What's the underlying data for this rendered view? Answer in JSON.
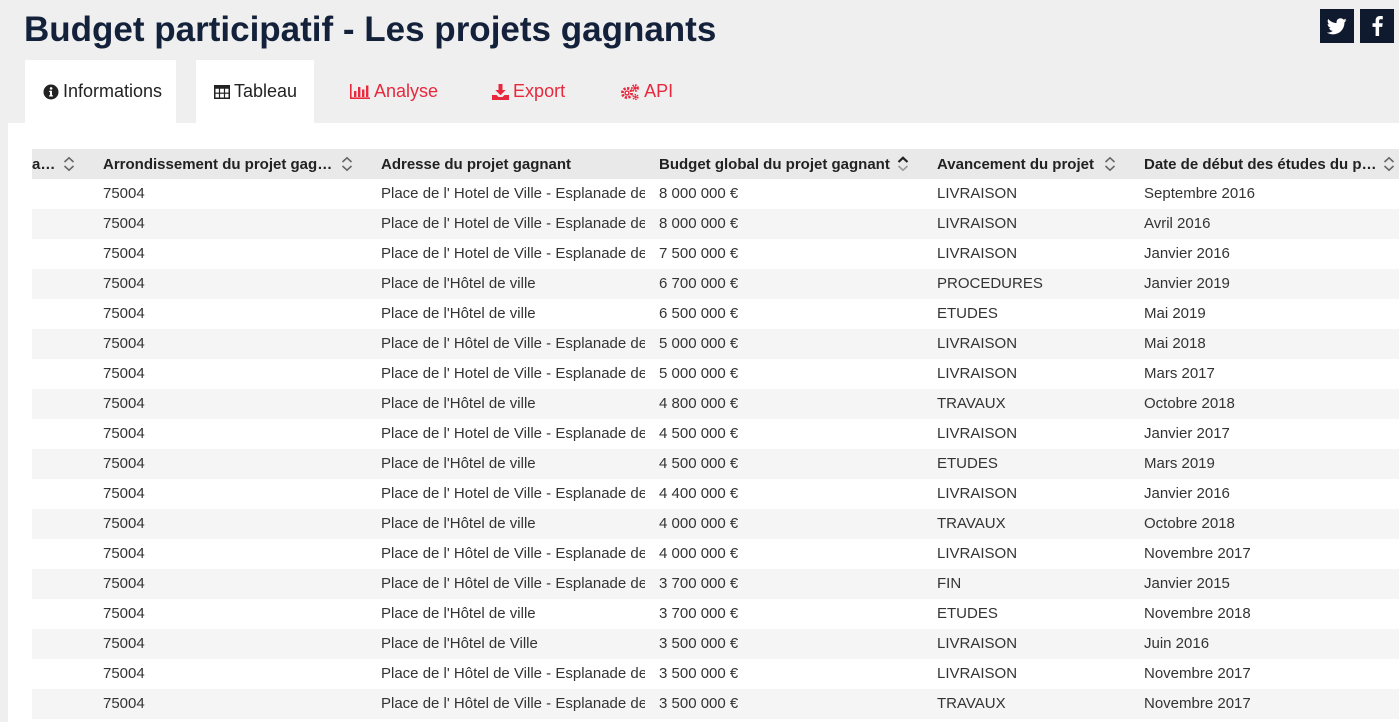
{
  "page": {
    "title": "Budget participatif - Les projets gagnants"
  },
  "social": [
    {
      "name": "twitter-icon"
    },
    {
      "name": "facebook-icon"
    }
  ],
  "tabs": [
    {
      "id": "tab-info",
      "label": "Informations",
      "icon": "info-circle-icon",
      "active": true
    },
    {
      "id": "tab-table",
      "label": "Tableau",
      "icon": "table-icon",
      "active": false
    },
    {
      "id": "tab-analyse",
      "label": "Analyse",
      "icon": "bar-chart-icon",
      "active": false
    },
    {
      "id": "tab-export",
      "label": "Export",
      "icon": "download-icon",
      "active": false
    },
    {
      "id": "tab-api",
      "label": "API",
      "icon": "cogs-icon",
      "active": false
    }
  ],
  "colors": {
    "title": "#14213a",
    "tab_accent": "#e8283d",
    "social_bg": "#0f1a2e"
  },
  "table": {
    "columns": [
      {
        "key": "partial",
        "label": "aire"
      },
      {
        "key": "arrondissement",
        "label": "Arrondissement du projet gagnant"
      },
      {
        "key": "adresse",
        "label": "Adresse du projet gagnant"
      },
      {
        "key": "budget",
        "label": "Budget global du projet gagnant",
        "sort": "desc"
      },
      {
        "key": "avancement",
        "label": "Avancement du projet"
      },
      {
        "key": "date",
        "label": "Date de début des études du projet"
      }
    ],
    "rows": [
      {
        "arrondissement": "75004",
        "adresse": "Place de l' Hotel de Ville - Esplanade de",
        "budget": "8 000 000 €",
        "avancement": "LIVRAISON",
        "date": "Septembre 2016"
      },
      {
        "arrondissement": "75004",
        "adresse": "Place de l' Hotel de Ville - Esplanade de",
        "budget": "8 000 000 €",
        "avancement": "LIVRAISON",
        "date": "Avril 2016"
      },
      {
        "arrondissement": "75004",
        "adresse": "Place de l' Hotel de Ville - Esplanade de",
        "budget": "7 500 000 €",
        "avancement": "LIVRAISON",
        "date": "Janvier 2016"
      },
      {
        "arrondissement": "75004",
        "adresse": "Place de l'Hôtel de ville",
        "budget": "6 700 000 €",
        "avancement": "PROCEDURES",
        "date": "Janvier 2019"
      },
      {
        "arrondissement": "75004",
        "adresse": "Place de l'Hôtel de ville",
        "budget": "6 500 000 €",
        "avancement": "ETUDES",
        "date": "Mai 2019"
      },
      {
        "arrondissement": "75004",
        "adresse": "Place de l' Hôtel de Ville - Esplanade de",
        "budget": "5 000 000 €",
        "avancement": "LIVRAISON",
        "date": "Mai 2018"
      },
      {
        "arrondissement": "75004",
        "adresse": "Place de l' Hotel de Ville - Esplanade de",
        "budget": "5 000 000 €",
        "avancement": "LIVRAISON",
        "date": "Mars 2017"
      },
      {
        "arrondissement": "75004",
        "adresse": "Place de l'Hôtel de ville",
        "budget": "4 800 000 €",
        "avancement": "TRAVAUX",
        "date": "Octobre 2018"
      },
      {
        "arrondissement": "75004",
        "adresse": "Place de l' Hotel de Ville - Esplanade de",
        "budget": "4 500 000 €",
        "avancement": "LIVRAISON",
        "date": "Janvier 2017"
      },
      {
        "arrondissement": "75004",
        "adresse": "Place de l'Hôtel de ville",
        "budget": "4 500 000 €",
        "avancement": "ETUDES",
        "date": "Mars 2019"
      },
      {
        "arrondissement": "75004",
        "adresse": "Place de l' Hotel de Ville - Esplanade de",
        "budget": "4 400 000 €",
        "avancement": "LIVRAISON",
        "date": "Janvier 2016"
      },
      {
        "arrondissement": "75004",
        "adresse": "Place de l'Hôtel de ville",
        "budget": "4 000 000 €",
        "avancement": "TRAVAUX",
        "date": "Octobre 2018"
      },
      {
        "arrondissement": "75004",
        "adresse": "Place de l' Hôtel de Ville - Esplanade de",
        "budget": "4 000 000 €",
        "avancement": "LIVRAISON",
        "date": "Novembre 2017"
      },
      {
        "arrondissement": "75004",
        "adresse": "Place de l' Hôtel de Ville - Esplanade de",
        "budget": "3 700 000 €",
        "avancement": "FIN",
        "date": "Janvier 2015"
      },
      {
        "arrondissement": "75004",
        "adresse": "Place de l'Hôtel de ville",
        "budget": "3 700 000 €",
        "avancement": "ETUDES",
        "date": "Novembre 2018"
      },
      {
        "arrondissement": "75004",
        "adresse": "Place de l'Hôtel de Ville",
        "budget": "3 500 000 €",
        "avancement": "LIVRAISON",
        "date": "Juin 2016"
      },
      {
        "arrondissement": "75004",
        "adresse": "Place de l' Hôtel de Ville - Esplanade de",
        "budget": "3 500 000 €",
        "avancement": "LIVRAISON",
        "date": "Novembre 2017"
      },
      {
        "arrondissement": "75004",
        "adresse": "Place de l' Hôtel de Ville - Esplanade de",
        "budget": "3 500 000 €",
        "avancement": "TRAVAUX",
        "date": "Novembre 2017"
      }
    ]
  }
}
